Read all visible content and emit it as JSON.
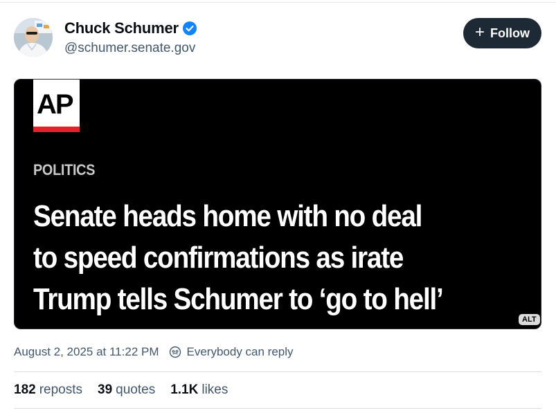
{
  "author": {
    "display_name": "Chuck Schumer",
    "handle": "@schumer.senate.gov",
    "verified": true,
    "avatar_icon": "avatar-photo"
  },
  "follow_button": {
    "label": "Follow",
    "icon": "plus-icon"
  },
  "embed": {
    "source_logo": "AP",
    "section": "POLITICS",
    "headline_lines": [
      "Senate heads home with no deal",
      "to speed confirmations as irate",
      "Trump tells Schumer to ‘go to hell’"
    ],
    "alt_badge": "ALT"
  },
  "meta": {
    "timestamp": "August 2, 2025 at 11:22 PM",
    "reply_setting": "Everybody can reply"
  },
  "stats": [
    {
      "count": "182",
      "label": "reposts"
    },
    {
      "count": "39",
      "label": "quotes"
    },
    {
      "count": "1.1K",
      "label": "likes"
    }
  ],
  "colors": {
    "accent_button": "#1e2936",
    "verified_blue": "#1083fe",
    "ap_red": "#e4202e",
    "muted_text": "#42576c"
  }
}
